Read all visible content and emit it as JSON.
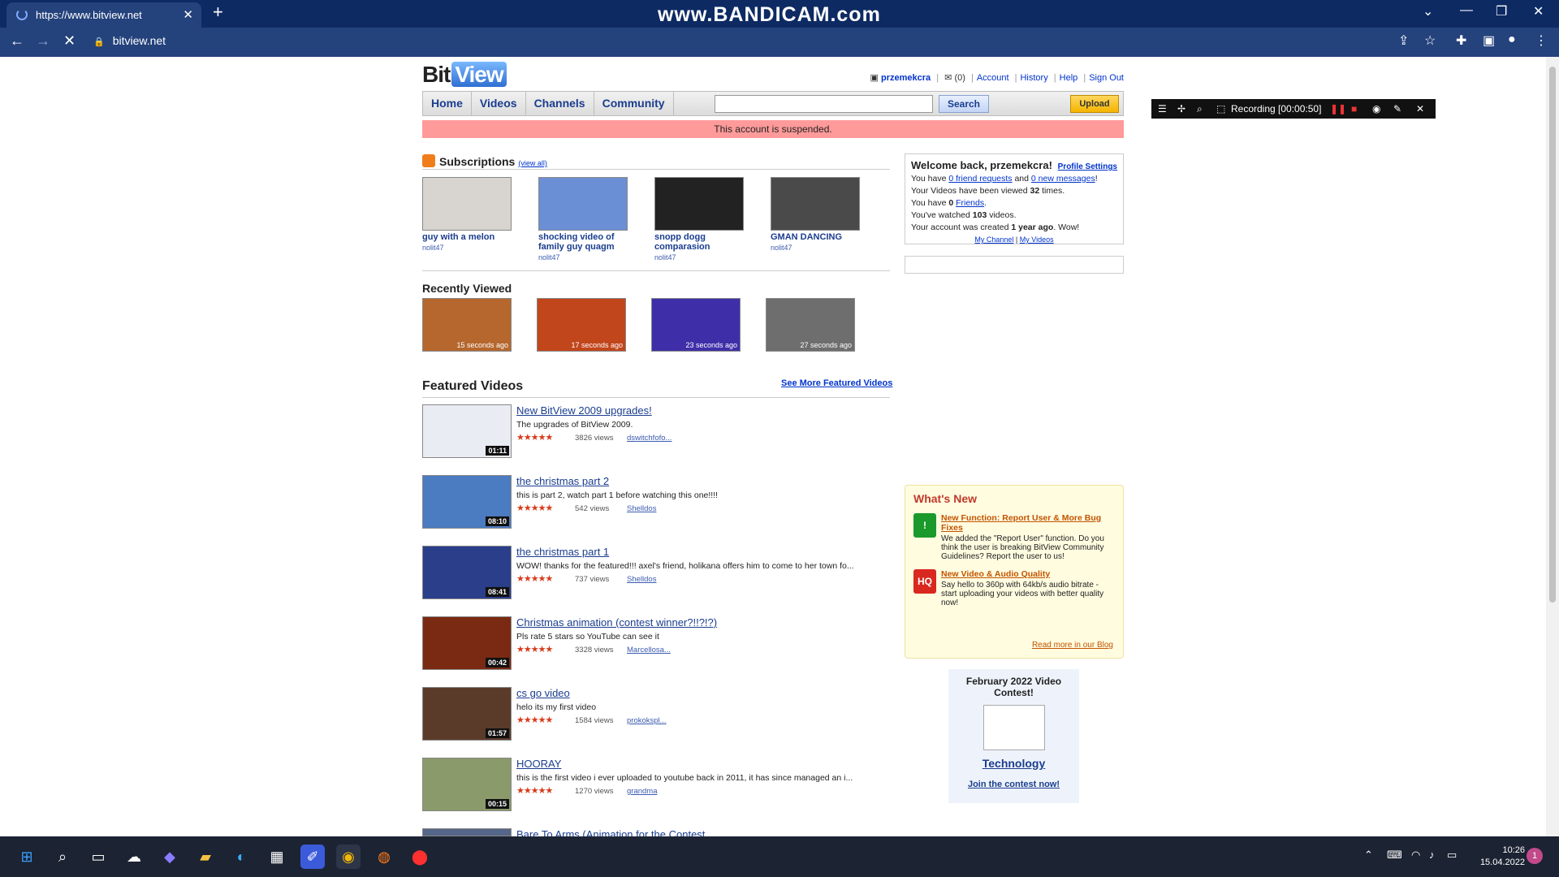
{
  "browser": {
    "tab_title": "https://www.bitview.net",
    "url": "bitview.net",
    "watermark": "www.BANDICAM.com"
  },
  "logo": {
    "part1": "Bit",
    "part2": "View"
  },
  "user": {
    "name": "przemekcra",
    "messages": "(0)",
    "links": [
      "Account",
      "History",
      "Help",
      "Sign Out"
    ]
  },
  "nav": {
    "items": [
      "Home",
      "Videos",
      "Channels",
      "Community"
    ],
    "search_label": "Search",
    "upload_label": "Upload"
  },
  "alert": "This account is suspended.",
  "subscriptions": {
    "title": "Subscriptions",
    "view_all": "(view all)",
    "videos": [
      {
        "title": "guy with a melon",
        "user": "nolit47",
        "color": "#d8d4cf"
      },
      {
        "title": "shocking video of family guy quagm",
        "user": "nolit47",
        "color": "#6b8fd4"
      },
      {
        "title": "snopp dogg comparasion",
        "user": "nolit47",
        "color": "#222222"
      },
      {
        "title": "GMAN DANCING",
        "user": "nolit47",
        "color": "#4a4a4a"
      }
    ]
  },
  "recently_viewed": {
    "title": "Recently Viewed",
    "videos": [
      {
        "ago": "15 seconds ago",
        "color": "#b5672e"
      },
      {
        "ago": "17 seconds ago",
        "color": "#c2461c"
      },
      {
        "ago": "23 seconds ago",
        "color": "#3e2fa8"
      },
      {
        "ago": "27 seconds ago",
        "color": "#6e6e6e"
      }
    ]
  },
  "featured": {
    "title": "Featured Videos",
    "see_more": "See More Featured Videos",
    "videos": [
      {
        "title": "New BitView 2009 upgrades!",
        "desc": "The upgrades of BitView 2009.",
        "stars": "★★★★★",
        "views": "3826 views",
        "author": "dswitchfofo...",
        "duration": "01:11",
        "color": "#e9ecf2"
      },
      {
        "title": "the christmas part 2",
        "desc": "this is part 2, watch part 1 before watching this one!!!!",
        "stars": "★★★★★",
        "views": "542 views",
        "author": "Shelldos",
        "duration": "08:10",
        "color": "#4b7bc0"
      },
      {
        "title": "the christmas part 1",
        "desc": "WOW! thanks for the featured!!! axel's friend, holikana offers him to come to her town fo...",
        "stars": "★★★★★",
        "views": "737 views",
        "author": "Shelldos",
        "duration": "08:41",
        "color": "#2a3e8a"
      },
      {
        "title": "Christmas animation (contest winner?!!?!?)",
        "desc": "Pls rate 5 stars so YouTube can see it",
        "stars": "★★★★★",
        "views": "3328 views",
        "author": "Marcellosa...",
        "duration": "00:42",
        "color": "#7a2a12"
      },
      {
        "title": "cs go video",
        "desc": "helo its my first video",
        "stars": "★★★★★",
        "views": "1584 views",
        "author": "prokokspl...",
        "duration": "01:57",
        "color": "#5a3b2a"
      },
      {
        "title": "HOORAY",
        "desc": "this is the first video i ever uploaded to youtube back in 2011, it has since managed an i...",
        "stars": "★★★★★",
        "views": "1270 views",
        "author": "grandma",
        "duration": "00:15",
        "color": "#8a9a6a"
      },
      {
        "title": "Bare To Arms (Animation for the Contest",
        "desc": "",
        "stars": "",
        "views": "",
        "author": "",
        "duration": "",
        "color": "#556688"
      }
    ]
  },
  "welcome": {
    "title": "Welcome back, przemekcra!",
    "profile_settings": "Profile Settings",
    "line1_a": "You have ",
    "friend_requests": "0 friend requests",
    "line1_b": " and ",
    "new_messages": "0 new messages",
    "line1_c": "!",
    "line2_a": "Your Videos have been viewed ",
    "line2_b": "32",
    "line2_c": " times.",
    "line3_a": "You have ",
    "line3_b": "0",
    "line3_c": " ",
    "friends": "Friends",
    "line3_d": ".",
    "line4_a": "You've watched ",
    "line4_b": "103",
    "line4_c": " videos.",
    "line5_a": "Your account was created ",
    "line5_b": "1 year ago",
    "line5_c": ". Wow!",
    "my_channel": "My Channel",
    "my_videos": "My Videos"
  },
  "whats_new": {
    "title": "What's New",
    "items": [
      {
        "title": "New Function: Report User & More Bug Fixes",
        "body": "We added the \"Report User\" function. Do you think the user is breaking BitView Community Guidelines? Report the user to us!",
        "icon": "!",
        "color": "#1a9a2a"
      },
      {
        "title": "New Video & Audio Quality",
        "body": "Say hello to 360p with 64kb/s audio bitrate - start uploading your videos with better quality now!",
        "icon": "HQ",
        "color": "#d9281f"
      }
    ],
    "read_more": "Read more in our Blog"
  },
  "contest": {
    "title": "February 2022 Video Contest!",
    "category": "Technology",
    "join": "Join the contest now!"
  },
  "recording": {
    "label": "Recording [00:00:50]"
  },
  "clock": {
    "time": "10:26",
    "date": "15.04.2022"
  }
}
